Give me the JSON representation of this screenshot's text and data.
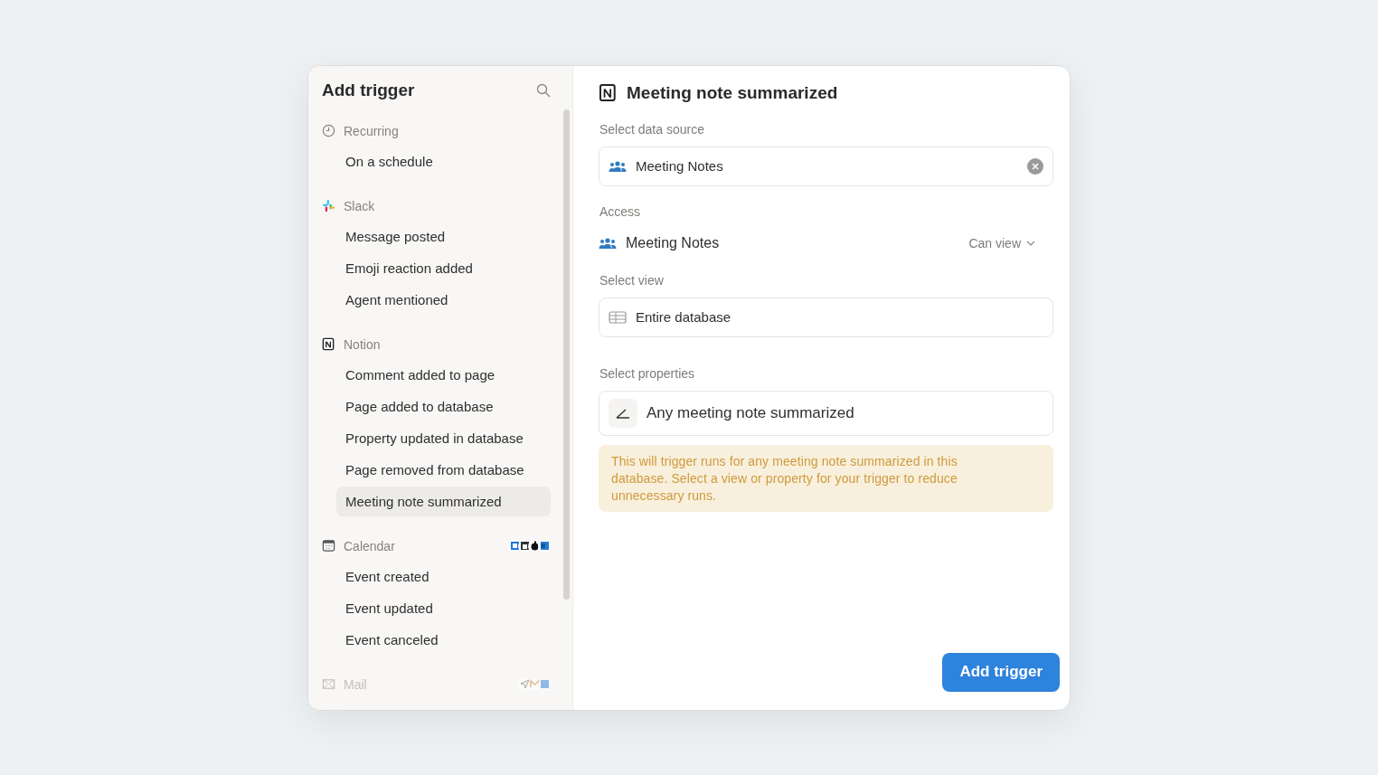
{
  "sidebar": {
    "title": "Add trigger",
    "groups": [
      {
        "kind": "recurring",
        "label": "Recurring",
        "disabled": false,
        "items": [
          {
            "label": "On a schedule",
            "selected": false
          }
        ]
      },
      {
        "kind": "slack",
        "label": "Slack",
        "disabled": false,
        "items": [
          {
            "label": "Message posted",
            "selected": false
          },
          {
            "label": "Emoji reaction added",
            "selected": false
          },
          {
            "label": "Agent mentioned",
            "selected": false
          }
        ]
      },
      {
        "kind": "notion",
        "label": "Notion",
        "disabled": false,
        "items": [
          {
            "label": "Comment added to page",
            "selected": false
          },
          {
            "label": "Page added to database",
            "selected": false
          },
          {
            "label": "Property updated in database",
            "selected": false
          },
          {
            "label": "Page removed from database",
            "selected": false
          },
          {
            "label": "Meeting note summarized",
            "selected": true
          }
        ]
      },
      {
        "kind": "calendar",
        "label": "Calendar",
        "disabled": false,
        "items": [
          {
            "label": "Event created",
            "selected": false
          },
          {
            "label": "Event updated",
            "selected": false
          },
          {
            "label": "Event canceled",
            "selected": false
          }
        ]
      },
      {
        "kind": "mail",
        "label": "Mail",
        "disabled": true
      }
    ]
  },
  "detail": {
    "title": "Meeting note summarized",
    "data_source": {
      "label": "Select data source",
      "value": "Meeting Notes"
    },
    "access": {
      "label": "Access",
      "name": "Meeting Notes",
      "permission": "Can view"
    },
    "view": {
      "label": "Select view",
      "value": "Entire database"
    },
    "properties": {
      "label": "Select properties",
      "value": "Any meeting note summarized"
    },
    "warning": "This will trigger runs for any meeting note summarized in this database. Select a view or property for your trigger to reduce unnecessary runs.",
    "submit": "Add trigger"
  }
}
